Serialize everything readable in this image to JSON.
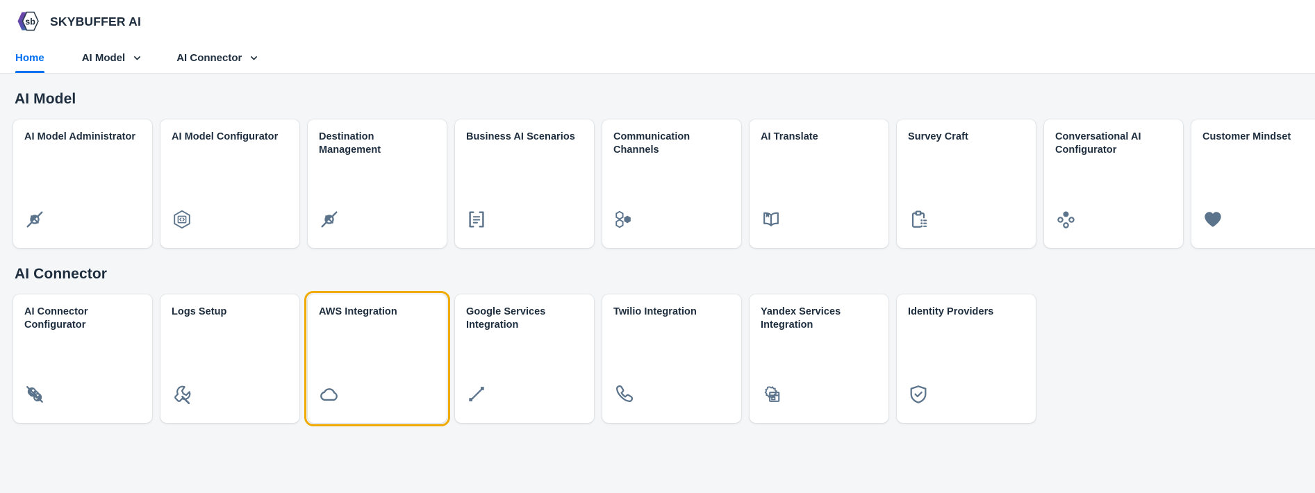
{
  "header": {
    "logo_icon": "skybuffer-hexagon-logo",
    "logo_text": "sb",
    "brand_name": "SKYBUFFER AI"
  },
  "nav": {
    "items": [
      {
        "label": "Home",
        "active": true,
        "has_chevron": false,
        "icon": ""
      },
      {
        "label": "AI Model",
        "active": false,
        "has_chevron": true,
        "icon": "chevron-down-icon"
      },
      {
        "label": "AI Connector",
        "active": false,
        "has_chevron": true,
        "icon": "chevron-down-icon"
      }
    ]
  },
  "colors": {
    "accent_blue": "#0070f2",
    "focus_amber": "#f0ab00",
    "icon_slate": "#5b738b",
    "text_dark": "#1d2d3e",
    "page_bg": "#f5f6f7",
    "tile_bg": "#ffffff"
  },
  "sections": [
    {
      "title": "AI Model",
      "tiles": [
        {
          "title": "AI Model Administrator",
          "icon": "plug-connection-icon",
          "focused": false
        },
        {
          "title": "AI Model Configurator",
          "icon": "hexagon-code-icon",
          "focused": false
        },
        {
          "title": "Destination Management",
          "icon": "plug-connection-icon",
          "focused": false
        },
        {
          "title": "Business AI Scenarios",
          "icon": "document-list-icon",
          "focused": false
        },
        {
          "title": "Communication Channels",
          "icon": "hexagon-cluster-icon",
          "focused": false
        },
        {
          "title": "AI Translate",
          "icon": "open-book-icon",
          "focused": false
        },
        {
          "title": "Survey Craft",
          "icon": "clipboard-list-icon",
          "focused": false
        },
        {
          "title": "Conversational AI Configurator",
          "icon": "connected-dots-icon",
          "focused": false
        },
        {
          "title": "Customer Mindset",
          "icon": "heart-icon",
          "focused": false
        }
      ]
    },
    {
      "title": "AI Connector",
      "tiles": [
        {
          "title": "AI Connector Configurator",
          "icon": "plug-disconnected-icon",
          "focused": false
        },
        {
          "title": "Logs Setup",
          "icon": "wrench-icon",
          "focused": false
        },
        {
          "title": "AWS Integration",
          "icon": "cloud-icon",
          "focused": true
        },
        {
          "title": "Google Services Integration",
          "icon": "diagonal-line-icon",
          "focused": false
        },
        {
          "title": "Twilio Integration",
          "icon": "phone-icon",
          "focused": false
        },
        {
          "title": "Yandex Services Integration",
          "icon": "gear-window-icon",
          "focused": false
        },
        {
          "title": "Identity Providers",
          "icon": "shield-check-icon",
          "focused": false
        }
      ]
    }
  ]
}
